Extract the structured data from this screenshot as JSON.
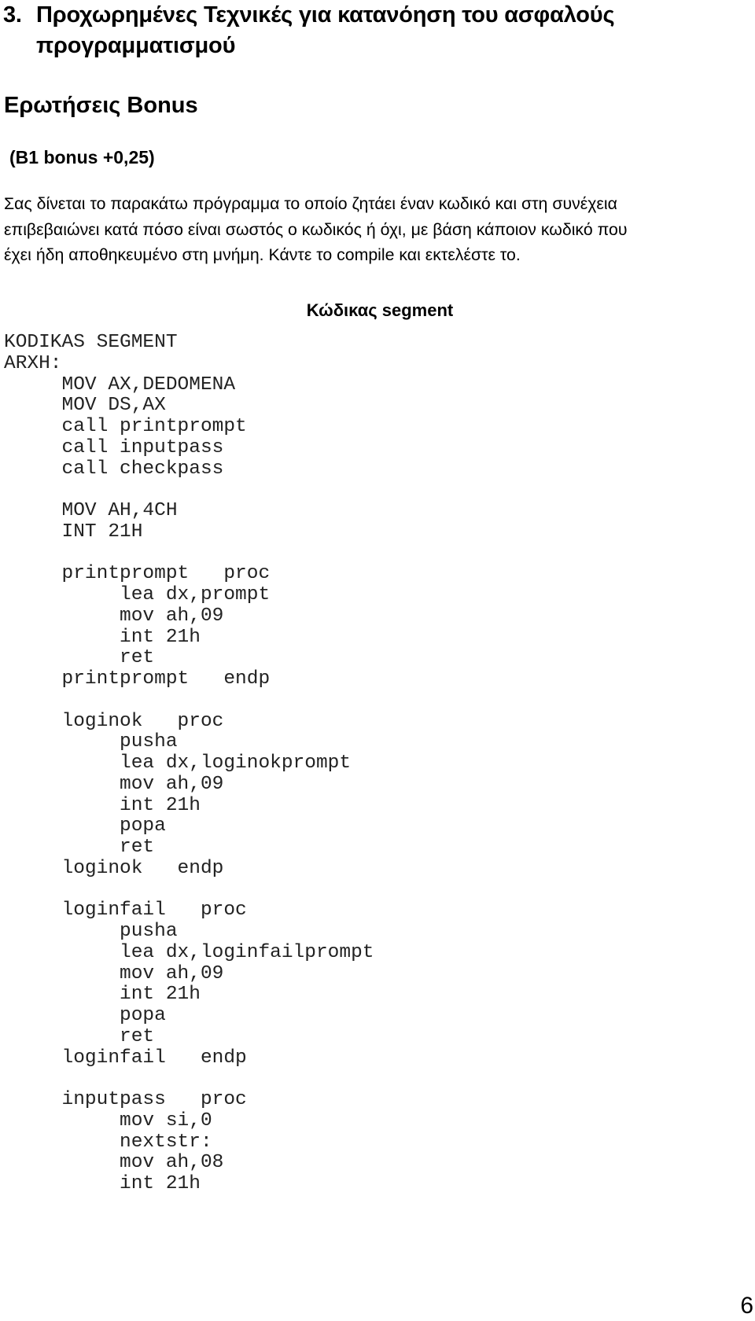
{
  "heading": {
    "number": "3.",
    "line1": "Προχωρημένες Τεχνικές για κατανόηση του ασφαλούς",
    "line2": "προγραμματισμού"
  },
  "subheading": "Ερωτήσεις Bonus",
  "bonus_label": "(B1 bonus +0,25)",
  "intro_paragraph": {
    "lines": [
      "Σας δίνεται το παρακάτω πρόγραμμα το οποίο ζητάει έναν κωδικό και στη συνέχεια",
      "επιβεβαιώνει κατά πόσο είναι σωστός ο κωδικός ή όχι, με βάση κάποιον κωδικό που",
      "έχει ήδη αποθηκευμένο στη μνήμη. Κάντε το compile και εκτελέστε το."
    ]
  },
  "code_caption": "Κώδικας segment",
  "code_lines": [
    "KODIKAS SEGMENT",
    "ARXH:",
    "     MOV AX,DEDOMENA",
    "     MOV DS,AX",
    "     call printprompt",
    "     call inputpass",
    "     call checkpass",
    "",
    "     MOV AH,4CH",
    "     INT 21H",
    "",
    "     printprompt   proc",
    "          lea dx,prompt",
    "          mov ah,09",
    "          int 21h",
    "          ret",
    "     printprompt   endp",
    "",
    "     loginok   proc",
    "          pusha",
    "          lea dx,loginokprompt",
    "          mov ah,09",
    "          int 21h",
    "          popa",
    "          ret",
    "     loginok   endp",
    "",
    "     loginfail   proc",
    "          pusha",
    "          lea dx,loginfailprompt",
    "          mov ah,09",
    "          int 21h",
    "          popa",
    "          ret",
    "     loginfail   endp",
    "",
    "     inputpass   proc",
    "          mov si,0",
    "          nextstr:",
    "          mov ah,08",
    "          int 21h"
  ],
  "page_number": "6"
}
